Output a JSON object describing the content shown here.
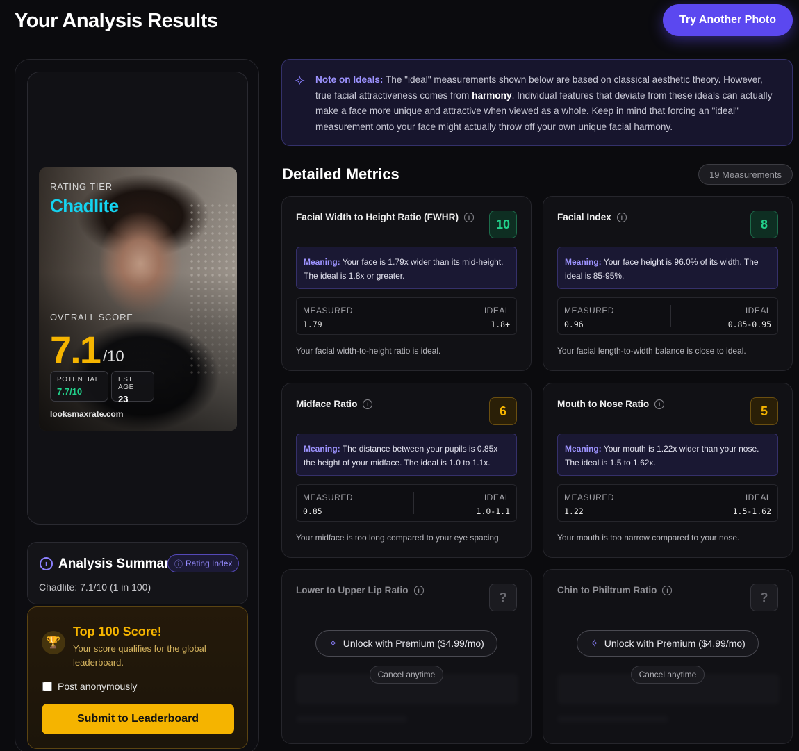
{
  "header": {
    "title": "Your Analysis Results",
    "try_button": "Try Another Photo"
  },
  "photo_card": {
    "rating_label": "RATING TIER",
    "rating_tier": "Chadlite",
    "overall_label": "OVERALL SCORE",
    "overall_score": "7.1",
    "overall_denominator": "/10",
    "potential_label": "POTENTIAL",
    "potential_value": "7.7/10",
    "age_label": "EST. AGE",
    "age_value": "23",
    "brand": "looksmaxrate.com"
  },
  "summary": {
    "title": "Analysis Summary",
    "rating_index_label": "Rating Index",
    "text": "Chadlite: 7.1/10 (1 in 100)"
  },
  "top_score": {
    "title": "Top 100 Score!",
    "description": "Your score qualifies for the global leaderboard.",
    "anon_label": "Post anonymously",
    "submit_label": "Submit to Leaderboard"
  },
  "note": {
    "label": "Note on Ideals:",
    "part1": " The \"ideal\" measurements shown below are based on classical aesthetic theory. However, true facial attractiveness comes from ",
    "highlight": "harmony",
    "part2": ". Individual features that deviate from these ideals can actually make a face more unique and attractive when viewed as a whole. Keep in mind that forcing an \"ideal\" measurement onto your face might actually throw off your own unique facial harmony."
  },
  "metrics": {
    "title": "Detailed Metrics",
    "count_badge": "19 Measurements",
    "measured_label": "MEASURED",
    "ideal_label": "IDEAL",
    "meaning_label": "Meaning:",
    "cards": [
      {
        "title": "Facial Width to Height Ratio (FWHR)",
        "score": "10",
        "meaning": "Your face is 1.79x wider than its mid-height. The ideal is 1.8x or greater.",
        "measured": "1.79",
        "ideal": "1.8+",
        "verdict": "Your facial width-to-height ratio is ideal."
      },
      {
        "title": "Facial Index",
        "score": "8",
        "meaning": "Your face height is 96.0% of its width. The ideal is 85-95%.",
        "measured": "0.96",
        "ideal": "0.85-0.95",
        "verdict": "Your facial length-to-width balance is close to ideal."
      },
      {
        "title": "Midface Ratio",
        "score": "6",
        "meaning": "The distance between your pupils is 0.85x the height of your midface. The ideal is 1.0 to 1.1x.",
        "measured": "0.85",
        "ideal": "1.0-1.1",
        "verdict": "Your midface is too long compared to your eye spacing."
      },
      {
        "title": "Mouth to Nose Ratio",
        "score": "5",
        "meaning": "Your mouth is 1.22x wider than your nose. The ideal is 1.5 to 1.62x.",
        "measured": "1.22",
        "ideal": "1.5-1.62",
        "verdict": "Your mouth is too narrow compared to your nose."
      }
    ],
    "locked_cards": [
      {
        "title": "Lower to Upper Lip Ratio",
        "score": "?"
      },
      {
        "title": "Chin to Philtrum Ratio",
        "score": "?"
      }
    ],
    "unlock_label": "Unlock with Premium ($4.99/mo)",
    "cancel_label": "Cancel anytime"
  },
  "colors": {
    "accent": "#5b48f0",
    "gold": "#f5b400",
    "green": "#22d18b",
    "cyan": "#14d3f0"
  }
}
